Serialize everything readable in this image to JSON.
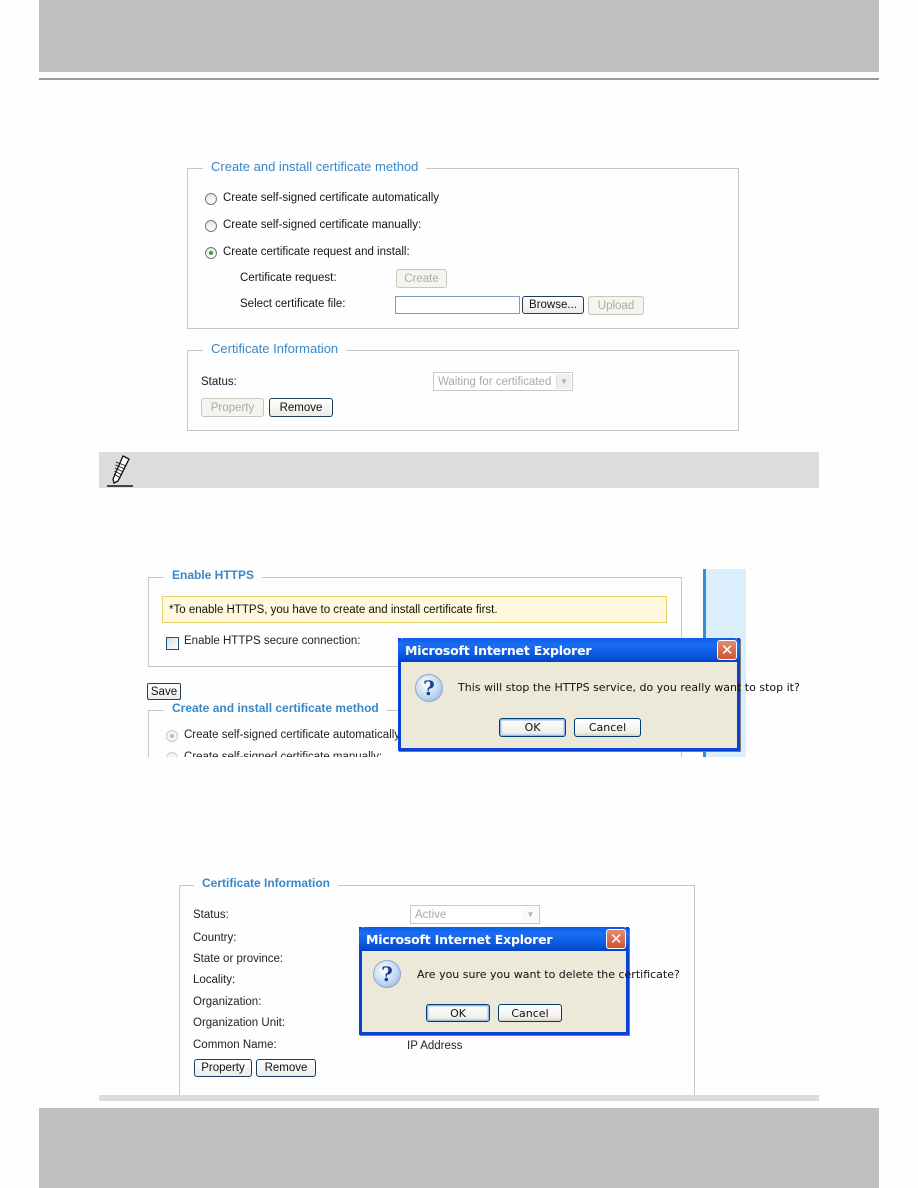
{
  "section1": {
    "method_legend": "Create and install certificate method",
    "radio_options": [
      {
        "label": "Create self-signed certificate automatically",
        "selected": false
      },
      {
        "label": "Create self-signed certificate manually:",
        "selected": false
      },
      {
        "label": "Create certificate request and install:",
        "selected": true
      }
    ],
    "cert_request_label": "Certificate request:",
    "create_button": "Create",
    "select_file_label": "Select certificate file:",
    "file_input_value": "",
    "browse_button": "Browse...",
    "upload_button": "Upload",
    "info_legend": "Certificate Information",
    "status_label": "Status:",
    "status_value": "Waiting for certificated",
    "property_button": "Property",
    "remove_button": "Remove"
  },
  "note": {
    "icon": "pencil-icon"
  },
  "section2": {
    "https_legend": "Enable HTTPS",
    "hint": "*To enable HTTPS, you have to create and install certificate first.",
    "enable_label": "Enable HTTPS secure connection:",
    "enable_checked": false,
    "save_button": "Save",
    "method_legend": "Create and install certificate method",
    "radio_options": [
      {
        "label": "Create self-signed certificate automatically",
        "selected": true
      },
      {
        "label": "Create self-signed certificate manually:",
        "selected": false
      }
    ],
    "dialog": {
      "title": "Microsoft Internet Explorer",
      "message": "This will stop the HTTPS service, do you really want to stop it?",
      "ok": "OK",
      "cancel": "Cancel"
    }
  },
  "section3": {
    "info_legend": "Certificate Information",
    "status_label": "Status:",
    "status_value": "Active",
    "fields": [
      {
        "label": "Country:",
        "value": ""
      },
      {
        "label": "State or province:",
        "value": ""
      },
      {
        "label": "Locality:",
        "value": ""
      },
      {
        "label": "Organization:",
        "value": ""
      },
      {
        "label": "Organization Unit:",
        "value": ""
      },
      {
        "label": "Common Name:",
        "value": "IP Address"
      }
    ],
    "property_button": "Property",
    "remove_button": "Remove",
    "dialog": {
      "title": "Microsoft Internet Explorer",
      "message": "Are you sure you want to delete the certificate?",
      "ok": "OK",
      "cancel": "Cancel"
    }
  }
}
